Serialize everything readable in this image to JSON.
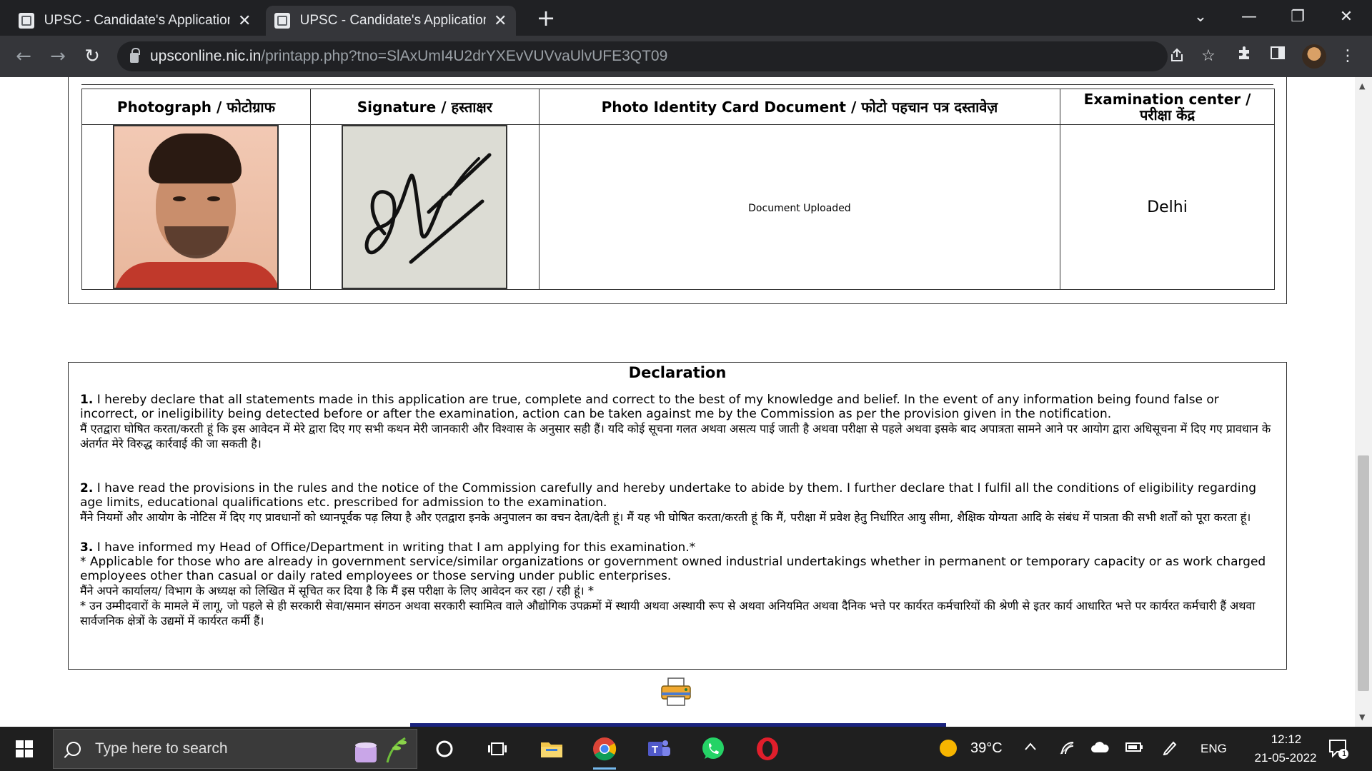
{
  "browser": {
    "tabs": [
      {
        "title": "UPSC - Candidate's Application D",
        "close": "✕"
      },
      {
        "title": "UPSC - Candidate's Application D",
        "close": "✕"
      }
    ],
    "new_tab": "+",
    "window_controls": {
      "collapse": "⌄",
      "minimize": "—",
      "restore": "❐",
      "close": "✕"
    },
    "nav": {
      "back": "←",
      "forward": "→",
      "reload": "↻"
    },
    "url": {
      "host": "upsconline.nic.in",
      "path": "/printapp.php?tno=SlAxUmI4U2drYXEvVUVvaUlvUFE3QT09"
    }
  },
  "documents_table": {
    "headers": [
      "Photograph / फोटोग्राफ",
      "Signature / हस्ताक्षर",
      "Photo Identity Card Document / फोटो पहचान पत्र दस्तावेज़",
      "Examination center / परीक्षा केंद्र"
    ],
    "id_document_status": "Document Uploaded",
    "exam_center": "Delhi"
  },
  "declaration": {
    "title": "Declaration",
    "items": [
      {
        "num": "1.",
        "en": "I hereby declare that all statements made in this application are true, complete and correct to the best of my knowledge and belief. In the event of any information being found false or incorrect, or ineligibility being detected before or after the examination, action can be taken against me by the Commission as per the provision given in the notification.",
        "hi": "मैं एतद्वारा घोषित करता/करती हूं कि इस आवेदन में मेरे द्वारा दिए गए सभी कथन मेरी जानकारी और विश्वास के अनुसार सही हैं। यदि कोई सूचना गलत अथवा असत्य पाई जाती है अथवा परीक्षा से पहले अथवा इसके बाद अपात्रता सामने आने पर आयोग द्वारा अधिसूचना में दिए गए प्रावधान के अंतर्गत मेरे विरुद्ध कार्रवाई की जा सकती है।"
      },
      {
        "num": "2.",
        "en": "I have read the provisions in the rules and the notice of the Commission carefully and hereby undertake to abide by them. I further declare that I fulfil all the conditions of eligibility regarding age limits, educational qualifications etc. prescribed for admission to the examination.",
        "hi": "मैंने नियमों और आयोग के नोटिस में दिए गए प्रावधानों को ध्यानपूर्वक पढ़ लिया है और एतद्वारा इनके अनुपालन का वचन देता/देती हूं। मैं यह भी घोषित करता/करती हूं कि मैं, परीक्षा में प्रवेश हेतु निर्धारित आयु सीमा, शैक्षिक योग्यता आदि के संबंध में पात्रता की सभी शर्तों को पूरा करता हूं।"
      },
      {
        "num": "3.",
        "en": "I have informed my Head of Office/Department in writing that I am applying for this examination.*",
        "en_note": "* Applicable for those who are already in government service/similar organizations or government owned industrial undertakings whether in permanent or temporary capacity or as work charged employees other than casual or daily rated employees or those serving under public enterprises.",
        "hi": "मैंने अपने कार्यालय/ विभाग के अध्यक्ष को लिखित में सूचित कर दिया है कि मैं इस परीक्षा के लिए आवेदन कर रहा / रही हूं। *",
        "hi_note": "* उन उम्मीदवारों के मामले में लागू, जो पहले से ही सरकारी सेवा/समान संगठन अथवा सरकारी स्वामित्व वाले औद्योगिक उपक्रमों में स्थायी अथवा अस्थायी रूप से अथवा अनियमित अथवा दैनिक भत्ते पर कार्यरत कर्मचारियों की श्रेणी से इतर कार्य आधारित भत्ते पर कार्यरत कर्मचारी हैं अथवा सार्वजनिक क्षेत्रों के उद्यमों में कार्यरत कर्मी हैं।"
      }
    ]
  },
  "taskbar": {
    "search_placeholder": "Type here to search",
    "weather": "39°C",
    "language": "ENG",
    "time": "12:12",
    "date": "21-05-2022",
    "notification_count": "1"
  },
  "icons": [
    "printer-icon",
    "chrome-icon",
    "teams-icon",
    "whatsapp-icon",
    "opera-icon",
    "file-explorer-icon"
  ]
}
